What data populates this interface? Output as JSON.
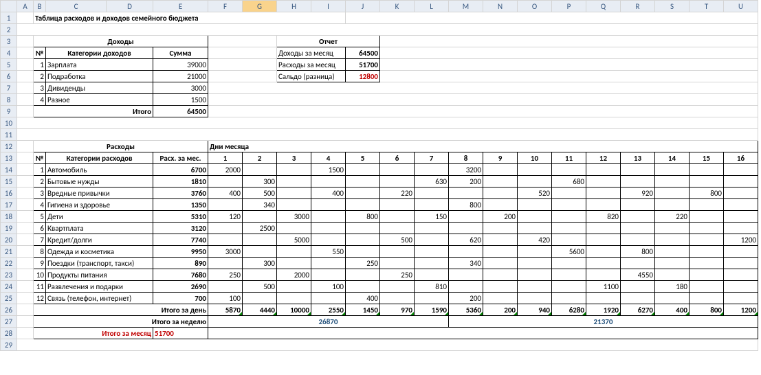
{
  "title": "Таблица расходов и доходов семейного бюджета",
  "income": {
    "section_title": "Доходы",
    "col_no": "№",
    "col_cat": "Категории доходов",
    "col_sum": "Сумма",
    "rows": [
      {
        "no": "1",
        "cat": "Зарплата",
        "sum": "39000"
      },
      {
        "no": "2",
        "cat": "Подработка",
        "sum": "21000"
      },
      {
        "no": "3",
        "cat": "Дивиденды",
        "sum": "3000"
      },
      {
        "no": "4",
        "cat": "Разное",
        "sum": "1500"
      }
    ],
    "total_label": "Итого",
    "total": "64500"
  },
  "report": {
    "title": "Отчет",
    "income_label": "Доходы за месяц",
    "income_val": "64500",
    "expense_label": "Расходы за месяц",
    "expense_val": "51700",
    "balance_label": "Сальдо (разница)",
    "balance_val": "12800"
  },
  "expense": {
    "section_title": "Расходы",
    "days_label": "Дни месяца",
    "col_no": "№",
    "col_cat": "Категории расходов",
    "col_sum": "Расх. за мес.",
    "day_headers": [
      "1",
      "2",
      "3",
      "4",
      "5",
      "6",
      "7",
      "8",
      "9",
      "10",
      "11",
      "12",
      "13",
      "14",
      "15",
      "16"
    ],
    "rows": [
      {
        "no": "1",
        "cat": "Автомобиль",
        "sum": "6700",
        "d": [
          "2000",
          "",
          "",
          "1500",
          "",
          "",
          "",
          "3200",
          "",
          "",
          "",
          "",
          "",
          "",
          "",
          ""
        ]
      },
      {
        "no": "2",
        "cat": "Бытовые нужды",
        "sum": "1810",
        "d": [
          "",
          "300",
          "",
          "",
          "",
          "",
          "630",
          "200",
          "",
          "",
          "680",
          "",
          "",
          "",
          "",
          ""
        ]
      },
      {
        "no": "3",
        "cat": "Вредные привычки",
        "sum": "3760",
        "d": [
          "400",
          "500",
          "",
          "400",
          "",
          "220",
          "",
          "",
          "",
          "520",
          "",
          "",
          "920",
          "",
          "800",
          ""
        ]
      },
      {
        "no": "4",
        "cat": "Гигиена и здоровье",
        "sum": "1350",
        "d": [
          "",
          "340",
          "",
          "",
          "",
          "",
          "",
          "800",
          "",
          "",
          "",
          "",
          "",
          "",
          "",
          ""
        ]
      },
      {
        "no": "5",
        "cat": "Дети",
        "sum": "5310",
        "d": [
          "120",
          "",
          "3000",
          "",
          "800",
          "",
          "150",
          "",
          "200",
          "",
          "",
          "820",
          "",
          "220",
          "",
          ""
        ]
      },
      {
        "no": "6",
        "cat": "Квартплата",
        "sum": "3120",
        "d": [
          "",
          "2500",
          "",
          "",
          "",
          "",
          "",
          "",
          "",
          "",
          "",
          "",
          "",
          "",
          "",
          ""
        ]
      },
      {
        "no": "7",
        "cat": "Кредит/долги",
        "sum": "7740",
        "d": [
          "",
          "",
          "5000",
          "",
          "",
          "500",
          "",
          "620",
          "",
          "420",
          "",
          "",
          "",
          "",
          "",
          "1200"
        ]
      },
      {
        "no": "8",
        "cat": "Одежда и косметика",
        "sum": "9950",
        "d": [
          "3000",
          "",
          "",
          "550",
          "",
          "",
          "",
          "",
          "",
          "",
          "5600",
          "",
          "800",
          "",
          "",
          ""
        ]
      },
      {
        "no": "9",
        "cat": "Поездки (транспорт, такси)",
        "sum": "890",
        "d": [
          "",
          "300",
          "",
          "",
          "250",
          "",
          "",
          "340",
          "",
          "",
          "",
          "",
          "",
          "",
          "",
          ""
        ]
      },
      {
        "no": "10",
        "cat": "Продукты питания",
        "sum": "7680",
        "d": [
          "250",
          "",
          "2000",
          "",
          "",
          "250",
          "",
          "",
          "",
          "",
          "",
          "",
          "4550",
          "",
          "",
          ""
        ]
      },
      {
        "no": "11",
        "cat": "Развлечения и подарки",
        "sum": "2690",
        "d": [
          "",
          "500",
          "",
          "100",
          "",
          "",
          "810",
          "",
          "",
          "",
          "",
          "1100",
          "",
          "180",
          "",
          ""
        ]
      },
      {
        "no": "12",
        "cat": "Связь (телефон, интернет)",
        "sum": "700",
        "d": [
          "100",
          "",
          "",
          "",
          "400",
          "",
          "",
          "200",
          "",
          "",
          "",
          "",
          "",
          "",
          "",
          ""
        ]
      }
    ],
    "day_total_label": "Итого за день",
    "day_totals": [
      "5870",
      "4440",
      "10000",
      "2550",
      "1450",
      "970",
      "1590",
      "5360",
      "200",
      "940",
      "6280",
      "1920",
      "6270",
      "400",
      "800",
      "1200"
    ],
    "week_total_label": "Итого за неделю",
    "week_totals": [
      "26870",
      "21370"
    ],
    "month_total_label": "Итого за месяц",
    "month_total": "51700"
  }
}
